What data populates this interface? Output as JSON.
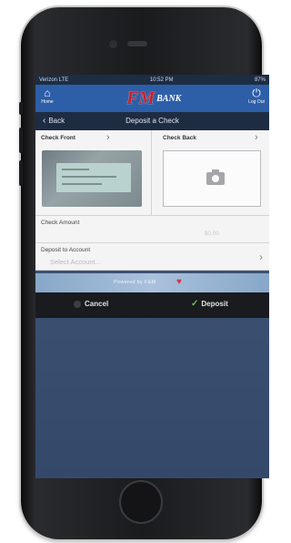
{
  "status_bar": {
    "carrier": "Verizon LTE",
    "time": "10:52 PM",
    "battery": "87%"
  },
  "header": {
    "home_label": "Home",
    "logoff_label": "Log Out",
    "logo_mark": "FM",
    "logo_word": "BANK"
  },
  "nav": {
    "back_label": "Back",
    "title": "Deposit a Check"
  },
  "checks": {
    "front_label": "Check Front",
    "back_label": "Check Back"
  },
  "amount": {
    "label": "Check Amount",
    "value": "$0.00"
  },
  "account": {
    "label": "Deposit to Account",
    "placeholder": "Select Account..."
  },
  "banner": {
    "text": "Powered by F&M"
  },
  "actions": {
    "cancel_label": "Cancel",
    "deposit_label": "Deposit"
  },
  "colors": {
    "header_blue": "#2d5ea8",
    "logo_red": "#c5202e",
    "deposit_green": "#6cc04a"
  },
  "icons": {
    "home": "home-icon",
    "logoff": "power-icon",
    "back": "chevron-left-icon",
    "camera": "camera-icon"
  }
}
